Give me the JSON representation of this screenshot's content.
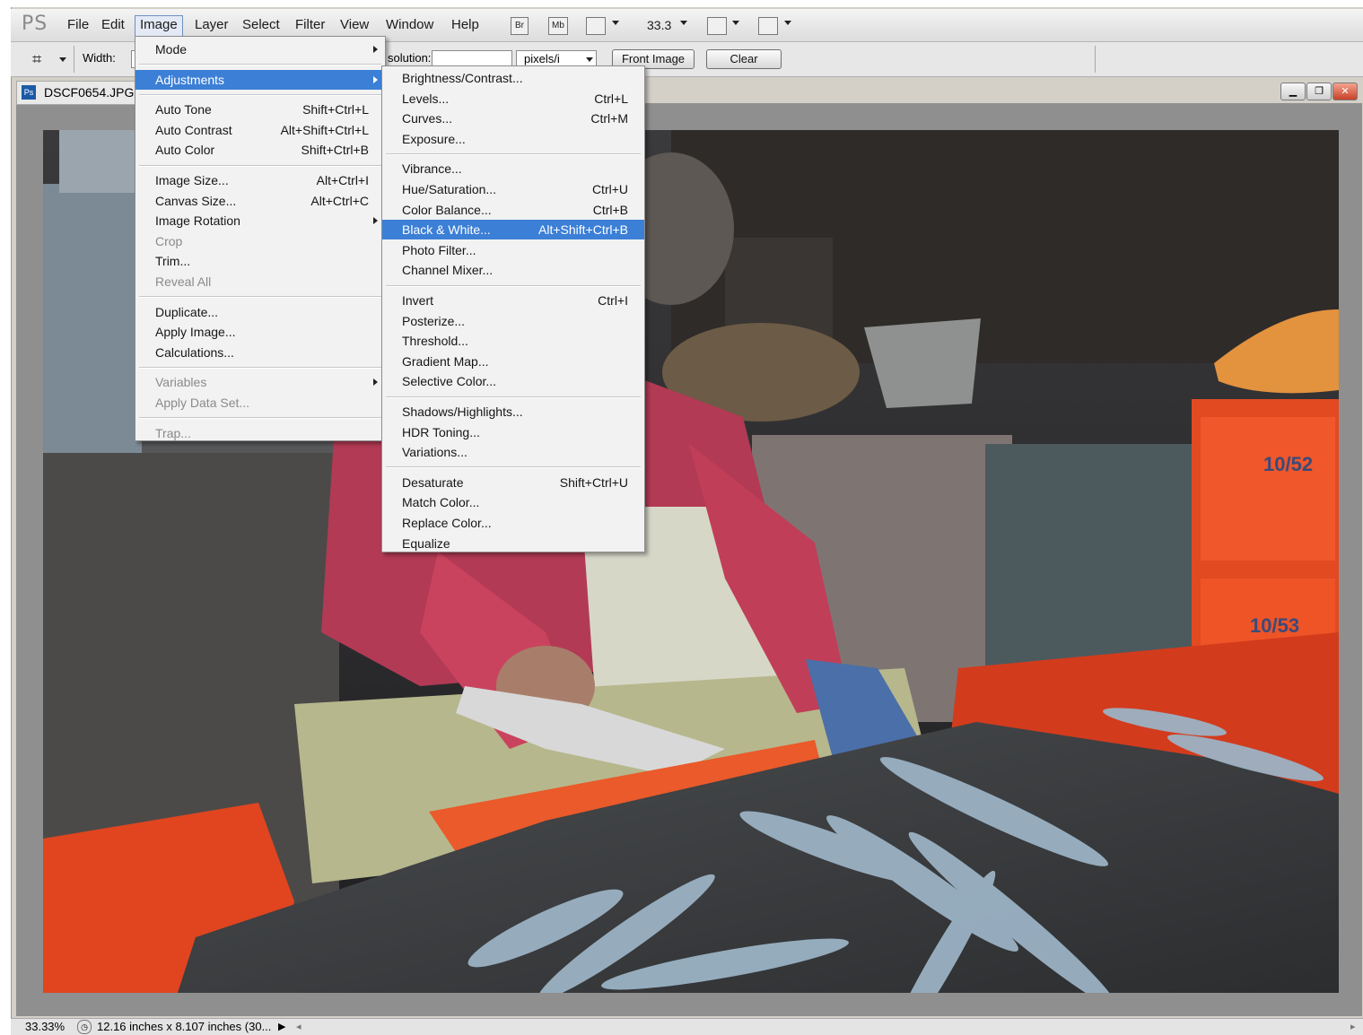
{
  "app": {
    "logo": "PS"
  },
  "menubar": {
    "items": [
      "File",
      "Edit",
      "Image",
      "Layer",
      "Select",
      "Filter",
      "View",
      "Window",
      "Help"
    ],
    "active": "Image",
    "bridge_icon": "Br",
    "minibridge_icon": "Mb",
    "zoom": "33.3"
  },
  "options": {
    "width_label": "Width:",
    "resolution_label": "solution:",
    "units": "pixels/i",
    "front_image_label": "Front Image",
    "clear_label": "Clear"
  },
  "document": {
    "tab_title": "DSCF0654.JPG"
  },
  "image_menu": {
    "items": [
      {
        "label": "Mode",
        "submenu": true
      },
      {
        "sep": true
      },
      {
        "label": "Adjustments",
        "submenu": true,
        "highlight": true
      },
      {
        "sep": true
      },
      {
        "label": "Auto Tone",
        "shortcut": "Shift+Ctrl+L"
      },
      {
        "label": "Auto Contrast",
        "shortcut": "Alt+Shift+Ctrl+L"
      },
      {
        "label": "Auto Color",
        "shortcut": "Shift+Ctrl+B"
      },
      {
        "sep": true
      },
      {
        "label": "Image Size...",
        "shortcut": "Alt+Ctrl+I"
      },
      {
        "label": "Canvas Size...",
        "shortcut": "Alt+Ctrl+C"
      },
      {
        "label": "Image Rotation",
        "submenu": true
      },
      {
        "label": "Crop",
        "disabled": true
      },
      {
        "label": "Trim..."
      },
      {
        "label": "Reveal All",
        "disabled": true
      },
      {
        "sep": true
      },
      {
        "label": "Duplicate..."
      },
      {
        "label": "Apply Image..."
      },
      {
        "label": "Calculations..."
      },
      {
        "sep": true
      },
      {
        "label": "Variables",
        "submenu": true,
        "disabled": true
      },
      {
        "label": "Apply Data Set...",
        "disabled": true
      },
      {
        "sep": true
      },
      {
        "label": "Trap...",
        "disabled": true
      }
    ]
  },
  "adjustments_menu": {
    "items": [
      {
        "label": "Brightness/Contrast..."
      },
      {
        "label": "Levels...",
        "shortcut": "Ctrl+L"
      },
      {
        "label": "Curves...",
        "shortcut": "Ctrl+M"
      },
      {
        "label": "Exposure..."
      },
      {
        "sep": true
      },
      {
        "label": "Vibrance..."
      },
      {
        "label": "Hue/Saturation...",
        "shortcut": "Ctrl+U"
      },
      {
        "label": "Color Balance...",
        "shortcut": "Ctrl+B"
      },
      {
        "label": "Black & White...",
        "shortcut": "Alt+Shift+Ctrl+B",
        "highlight": true
      },
      {
        "label": "Photo Filter..."
      },
      {
        "label": "Channel Mixer..."
      },
      {
        "sep": true
      },
      {
        "label": "Invert",
        "shortcut": "Ctrl+I"
      },
      {
        "label": "Posterize..."
      },
      {
        "label": "Threshold..."
      },
      {
        "label": "Gradient Map..."
      },
      {
        "label": "Selective Color..."
      },
      {
        "sep": true
      },
      {
        "label": "Shadows/Highlights..."
      },
      {
        "label": "HDR Toning..."
      },
      {
        "label": "Variations..."
      },
      {
        "sep": true
      },
      {
        "label": "Desaturate",
        "shortcut": "Shift+Ctrl+U"
      },
      {
        "label": "Match Color..."
      },
      {
        "label": "Replace Color..."
      },
      {
        "label": "Equalize"
      }
    ]
  },
  "photo": {
    "crate_label_1": "10/52",
    "crate_label_2": "10/53"
  },
  "status": {
    "zoom": "33.33%",
    "doc_info": "12.16 inches x 8.107 inches (30..."
  }
}
